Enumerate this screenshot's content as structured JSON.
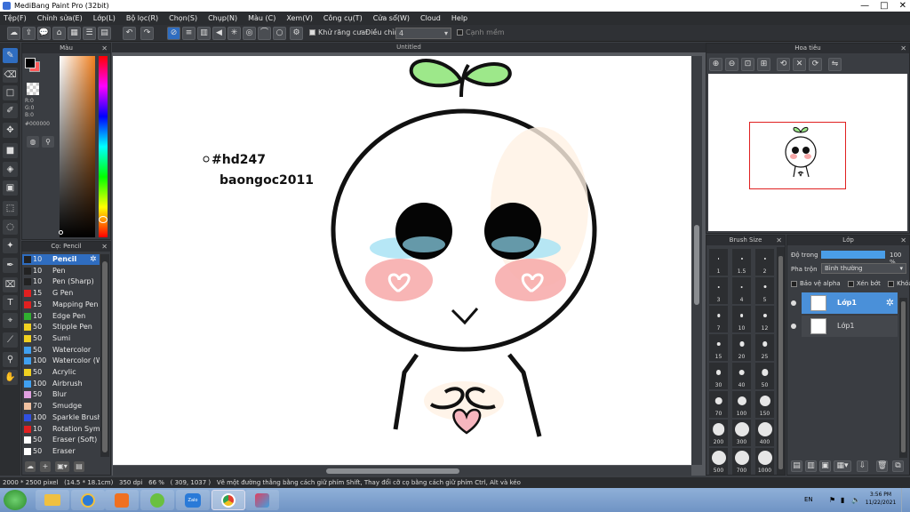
{
  "window": {
    "title": "MediBang Paint Pro (32bit)",
    "minimize": "—",
    "maximize": "□",
    "close": "✕"
  },
  "menu": [
    "Tệp(F)",
    "Chỉnh sửa(E)",
    "Lớp(L)",
    "Bộ lọc(R)",
    "Chọn(S)",
    "Chụp(N)",
    "Màu (C)",
    "Xem(V)",
    "Công cụ(T)",
    "Cửa sổ(W)",
    "Cloud",
    "Help"
  ],
  "toolbar": {
    "antialias_label": "Khử răng cưa",
    "adjust_label": "Điều chỉnh",
    "adjust_value": "4",
    "edge_label": "Cạnh mềm"
  },
  "color_panel": {
    "title": "Màu",
    "r": "R:0",
    "g": "G:0",
    "b": "B:0",
    "hex": "#000000",
    "fg_color": "#000000",
    "bg_color": "#ff5a5a"
  },
  "brush_panel": {
    "title": "Cọ: Pencil",
    "items": [
      {
        "size": "10",
        "name": "Pencil",
        "color": "#222222"
      },
      {
        "size": "10",
        "name": "Pen",
        "color": "#222222"
      },
      {
        "size": "10",
        "name": "Pen (Sharp)",
        "color": "#222222"
      },
      {
        "size": "15",
        "name": "G Pen",
        "color": "#e02020"
      },
      {
        "size": "15",
        "name": "Mapping Pen",
        "color": "#e02020"
      },
      {
        "size": "10",
        "name": "Edge Pen",
        "color": "#30b030"
      },
      {
        "size": "50",
        "name": "Stipple Pen",
        "color": "#f0d020"
      },
      {
        "size": "50",
        "name": "Sumi",
        "color": "#f0d020"
      },
      {
        "size": "50",
        "name": "Watercolor",
        "color": "#40a0f0"
      },
      {
        "size": "100",
        "name": "Watercolor (W",
        "color": "#40a0f0"
      },
      {
        "size": "50",
        "name": "Acrylic",
        "color": "#f0d020"
      },
      {
        "size": "100",
        "name": "Airbrush",
        "color": "#40a0f0"
      },
      {
        "size": "50",
        "name": "Blur",
        "color": "#e0a0e0"
      },
      {
        "size": "70",
        "name": "Smudge",
        "color": "#f0c0a0"
      },
      {
        "size": "100",
        "name": "Sparkle Brush",
        "color": "#3050e0"
      },
      {
        "size": "10",
        "name": "Rotation Symm",
        "color": "#e02020"
      },
      {
        "size": "50",
        "name": "Eraser (Soft)",
        "color": "#ffffff"
      },
      {
        "size": "50",
        "name": "Eraser",
        "color": "#ffffff"
      }
    ]
  },
  "canvas": {
    "tab_title": "Untitled",
    "text_line1": "#hd247",
    "text_line2": "baongoc2011"
  },
  "navigator": {
    "title": "Hoa tiêu"
  },
  "brush_size": {
    "title": "Brush Size",
    "sizes": [
      "1",
      "1.5",
      "2",
      "3",
      "4",
      "5",
      "7",
      "10",
      "12",
      "15",
      "20",
      "25",
      "30",
      "40",
      "50",
      "70",
      "100",
      "150",
      "200",
      "300",
      "400",
      "500",
      "700",
      "1000"
    ]
  },
  "layer_panel": {
    "title": "Lớp",
    "opacity_label": "Độ trong",
    "opacity_value": "100 %",
    "blend_label": "Pha trộn",
    "blend_value": "Bình thường",
    "protect_alpha": "Bảo vệ alpha",
    "clipping": "Xén bớt",
    "lock": "Khóa",
    "layers": [
      {
        "name": "Lớp1",
        "selected": true
      },
      {
        "name": "Lớp1",
        "selected": false
      }
    ]
  },
  "status": {
    "size": "2000 * 2500 pixel",
    "cm": "(14.5 * 18.1cm)",
    "dpi": "350 dpi",
    "zoom": "66 %",
    "coords": "( 309, 1037 )",
    "hint": "Vẽ một đường thẳng bằng cách giữ phím Shift, Thay đổi cỡ cọ bằng cách giữ phím Ctrl, Alt và kéo"
  },
  "taskbar": {
    "lang": "EN",
    "time": "3:56 PM",
    "date": "11/22/2021",
    "zalo": "Zalo"
  }
}
